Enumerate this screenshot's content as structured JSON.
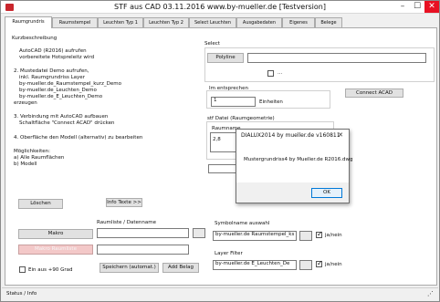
{
  "window": {
    "title": "STF aus CAD   03.11.2016   www.by-mueller.de   [Testversion]"
  },
  "tabs": [
    "Raumgrundris",
    "Raumstempel",
    "Leuchten Typ 1",
    "Leuchten Typ 2",
    "Select Leuchten",
    "Ausgabedaten",
    "Eigenes",
    "Belege"
  ],
  "description": {
    "heading": "Kurzbeschreibung",
    "lines": [
      "AutoCAD (R2016) aufrufen",
      "vorbereitete Hotspreleitz  wird",
      "2. Mustedatei Demo  aufrufen,",
      "inkl. Raumgrundriss Layer",
      "by-mueller.de_Raumstempel_kurz_Demo",
      "by-mueller.de_Leuchten_Demo",
      "by-mueller.de_E_Leuchten_Demo",
      "erzeugen",
      "3. Verbindung mit AutoCAD aufbauen",
      "Schaltfläche \"Connect ACAD\" drücken",
      "4. Oberfläche den Modell (alternativ) zu bearbeiten",
      "Möglichkeiten:",
      "a) Alle Raumflächen",
      "b) Modell"
    ]
  },
  "buttons": {
    "loeschen": "Löschen",
    "infotexte": "Info Texte >>",
    "makro": "Makro",
    "makro_raumliste": "Makro Raumliste",
    "speichern": "Speichern (automat.)",
    "add_belag": "Add Belag",
    "polyline": "Polyline",
    "connect": "Connect ACAD",
    "ok": "OK"
  },
  "select": {
    "label": "Select",
    "polyline_value": "",
    "checkbox_label": "..."
  },
  "intersection": {
    "label": "Im entsprechen",
    "value": "1",
    "unit": "Einheiten"
  },
  "stf_file": {
    "label": "stf Datei   (Raumgeometrie)",
    "column": "Raumname",
    "value": "2,8"
  },
  "ausgabe": {
    "label": "Raumliste / Datenname",
    "value": ""
  },
  "ein_aus": {
    "label": "Ein aus +90 Grad"
  },
  "symbolname": {
    "label": "Symbolname auswahl",
    "value": "by-mueller.de Raumstempel_ks",
    "check_label": "ja/nein"
  },
  "layer_filter": {
    "label": "Layer Filter",
    "value": "by-mueller.de E_Leuchten_De",
    "check_label": "ja/nein"
  },
  "dialog": {
    "title": "DIALUX2014  by  mueller.de  v160811",
    "message": "Mustergrundriss4 by Mueller.de R2016.dwg"
  },
  "status": {
    "text": "Status / Info"
  },
  "colors": {
    "close": "#e81123",
    "accent": "#c9252c",
    "pink_button": "#f3c8c8"
  }
}
